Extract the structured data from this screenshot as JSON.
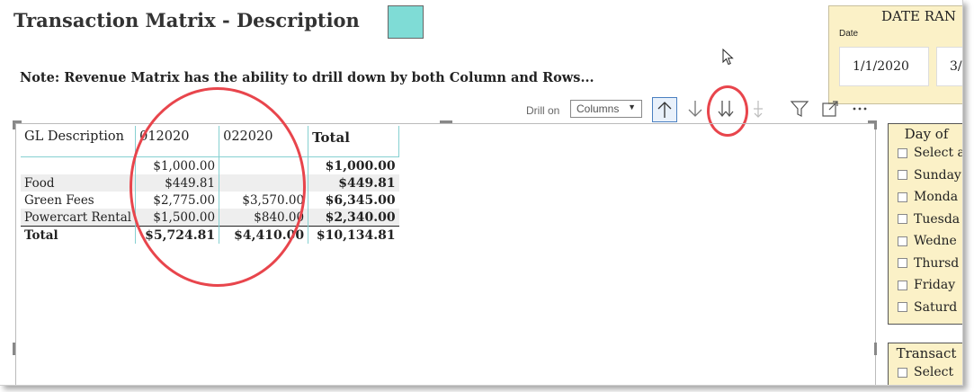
{
  "title": "Transaction Matrix - Description",
  "note": "Note: Revenue Matrix has the ability to drill down by both Column and Rows...",
  "accent_swatch_color": "#7fdcd6",
  "date_range": {
    "title": "DATE RAN",
    "label": "Date",
    "start": "1/1/2020",
    "end": "3/"
  },
  "toolbar": {
    "drill_label": "Drill on",
    "drill_value": "Columns",
    "icons": [
      "drill-up-icon",
      "drill-down-icon",
      "expand-next-level-icon",
      "expand-all-icon",
      "filter-icon",
      "focus-mode-icon",
      "more-options-icon"
    ]
  },
  "matrix": {
    "headers": [
      "GL Description",
      "012020",
      "022020",
      "Total"
    ],
    "rows": [
      {
        "label": "",
        "c1": "$1,000.00",
        "c2": "",
        "total": "$1,000.00"
      },
      {
        "label": "Food",
        "c1": "$449.81",
        "c2": "",
        "total": "$449.81"
      },
      {
        "label": "Green Fees",
        "c1": "$2,775.00",
        "c2": "$3,570.00",
        "total": "$6,345.00"
      },
      {
        "label": "Powercart Rental",
        "c1": "$1,500.00",
        "c2": "$840.00",
        "total": "$2,340.00"
      }
    ],
    "total_row": {
      "label": "Total",
      "c1": "$5,724.81",
      "c2": "$4,410.00",
      "total": "$10,134.81"
    }
  },
  "day_slicer": {
    "title": "Day of",
    "items": [
      "Select a",
      "Sunday",
      "Monda",
      "Tuesda",
      "Wedne",
      "Thursd",
      "Friday",
      "Saturd"
    ]
  },
  "transaction_slicer": {
    "title": "Transact",
    "items": [
      "Select"
    ]
  },
  "highlight_color": "#e8454c"
}
